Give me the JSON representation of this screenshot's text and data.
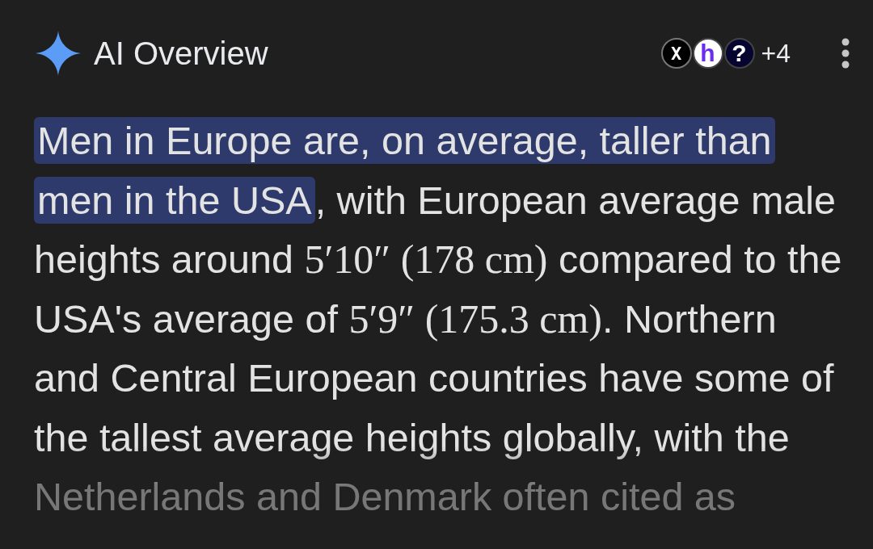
{
  "header": {
    "title": "AI Overview",
    "sources": [
      {
        "kind": "x",
        "glyph": "X"
      },
      {
        "kind": "h",
        "glyph": "h"
      },
      {
        "kind": "q",
        "glyph": "?"
      }
    ],
    "more_sources": "+4"
  },
  "overview": {
    "segments": [
      {
        "kind": "highlight",
        "text": "Men in Europe are, on average, taller than men in the USA"
      },
      {
        "kind": "plain",
        "text": ", with European average male heights around "
      },
      {
        "kind": "measure",
        "text": "5′10″ (178 cm)"
      },
      {
        "kind": "plain",
        "text": " compared to the USA's average of "
      },
      {
        "kind": "measure",
        "text": "5′9″ (175.3 cm)"
      },
      {
        "kind": "plain",
        "text": ". Northern and Central European countries have some of the tallest average heights globally, with the Netherlands and Denmark often cited as"
      }
    ]
  }
}
